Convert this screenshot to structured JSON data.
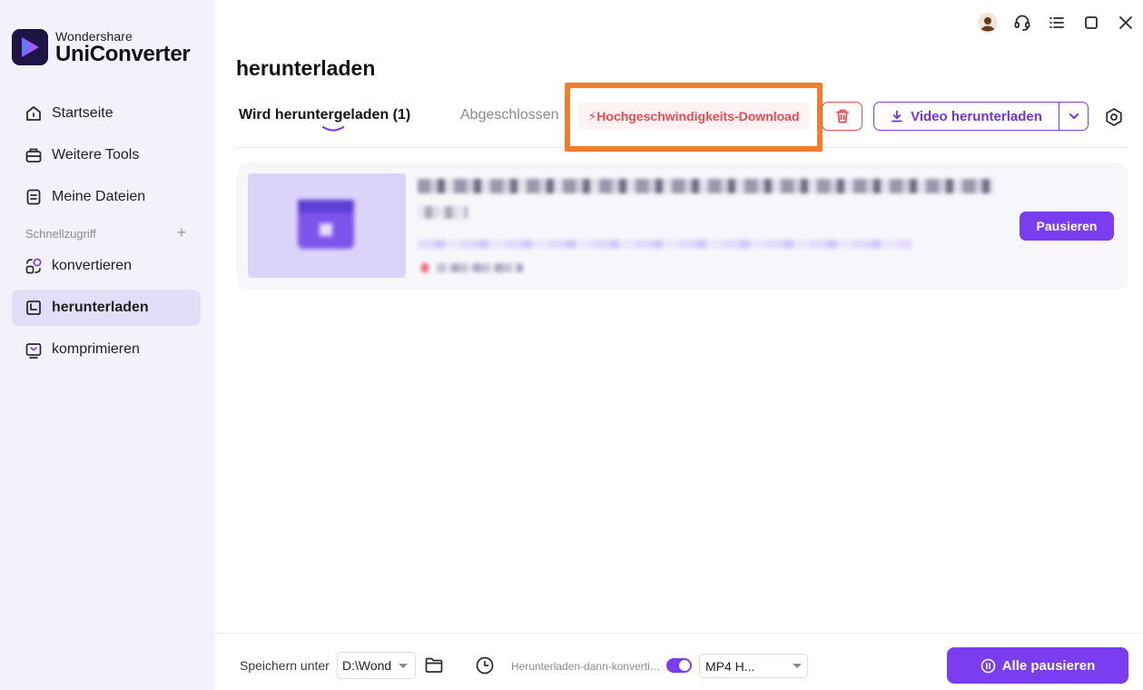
{
  "app": {
    "brand_small": "Wondershare",
    "brand_name": "UniConverter",
    "accent_color": "#7a3ef0",
    "highlight_color": "#f47d2c"
  },
  "sidebar": {
    "items": [
      {
        "label": "Startseite",
        "icon": "home-icon"
      },
      {
        "label": "Weitere Tools",
        "icon": "toolbox-icon"
      },
      {
        "label": "Meine Dateien",
        "icon": "file-icon"
      }
    ],
    "quick_access_label": "Schnellzugriff",
    "quick_items": [
      {
        "label": "konvertieren",
        "icon": "convert-icon"
      },
      {
        "label": "herunterladen",
        "icon": "download-icon",
        "active": true
      },
      {
        "label": "komprimieren",
        "icon": "compress-icon"
      }
    ]
  },
  "titlebar": {
    "icons": [
      "avatar-icon",
      "headset-icon",
      "menu-icon",
      "maximize-icon",
      "close-icon"
    ]
  },
  "main": {
    "title": "herunterladen",
    "tabs": [
      {
        "label": "Wird heruntergeladen (1)",
        "active": true
      },
      {
        "label": "Abgeschlossen",
        "active": false
      }
    ],
    "high_speed_label": "⚡Hochgeschwindigkeits-Download",
    "download_button_label": "Video herunterladen"
  },
  "download_item": {
    "pause_label": "Pausieren"
  },
  "bottom": {
    "save_label": "Speichern unter",
    "save_path": "D:\\Wondershare",
    "convert_label": "Herunterladen-dann-konvertieren-Modus",
    "convert_enabled": true,
    "format": "MP4 H...",
    "pause_all_label": "Alle pausieren"
  }
}
